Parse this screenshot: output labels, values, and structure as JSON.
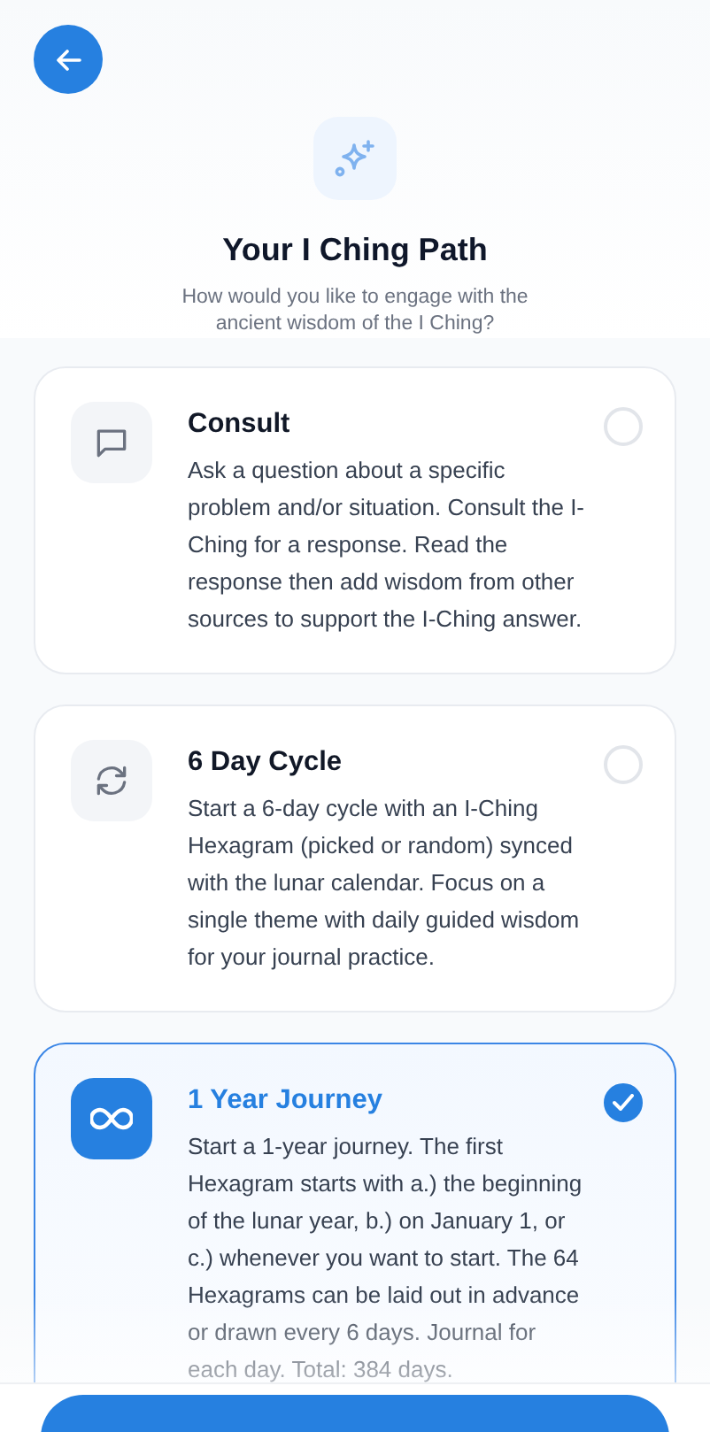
{
  "header": {
    "title": "Your I Ching Path",
    "subtitle": "How would you like to engage with the ancient wisdom of the I Ching?"
  },
  "options": [
    {
      "kind": "chat",
      "title": "Consult",
      "description": "Ask a question about a specific problem and/or situation. Consult the I-Ching for a response. Read the response then add wisdom from other sources to support the I-Ching answer.",
      "selected": false
    },
    {
      "kind": "cycle",
      "title": "6 Day Cycle",
      "description": "Start a 6-day cycle with an I-Ching Hexagram (picked or random) synced with the lunar calendar. Focus on a single theme with daily guided wisdom for your journal practice.",
      "selected": false
    },
    {
      "kind": "infinity",
      "title": "1 Year Journey",
      "description": "Start a 1-year journey. The first Hexagram starts with a.) the beginning of the lunar year, b.) on January 1, or c.) whenever you want to start. The 64 Hexagrams can be laid out in advance or drawn every 6 days. Journal for each day. Total: 384 days.",
      "selected": true
    }
  ]
}
